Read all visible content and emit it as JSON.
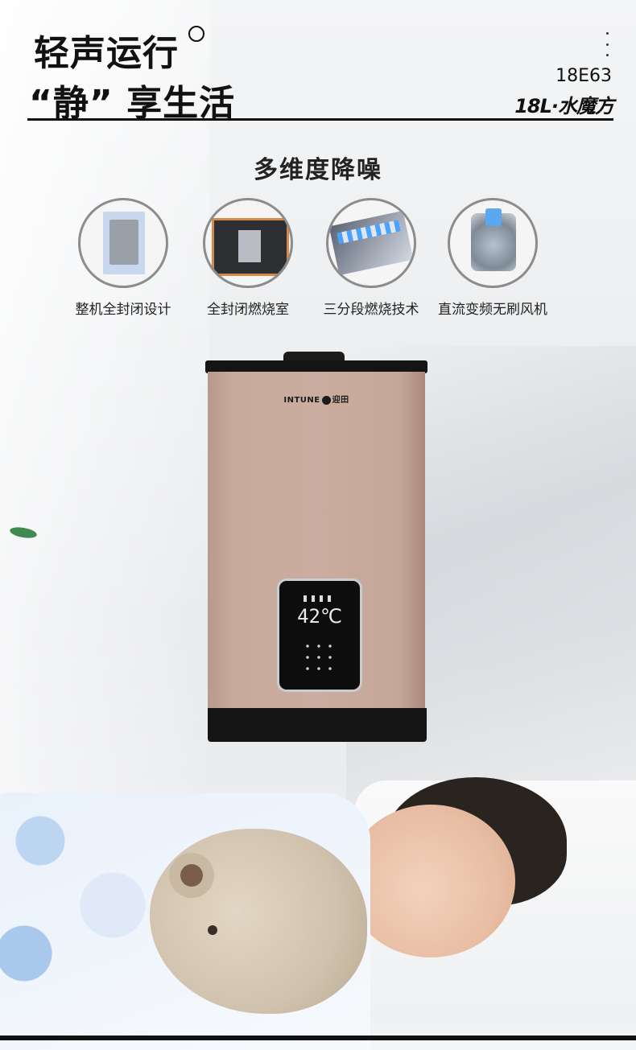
{
  "header": {
    "title_line1": "轻声运行",
    "title_line2": "“静” 享生活",
    "model_code": "18E63",
    "model_name": "18L·水魔方"
  },
  "section": {
    "title": "多维度降噪",
    "features": [
      {
        "label": "整机全封闭设计",
        "icon": "sealed-unit-icon"
      },
      {
        "label": "全封闭燃烧室",
        "icon": "combustion-chamber-icon"
      },
      {
        "label": "三分段燃烧技术",
        "icon": "burner-icon"
      },
      {
        "label": "直流变频无刷风机",
        "icon": "fan-motor-icon"
      }
    ]
  },
  "heater": {
    "brand": "INTUNE",
    "brand_cn": "迎田",
    "display_temp": "42℃",
    "color": "#c8aa9c"
  }
}
